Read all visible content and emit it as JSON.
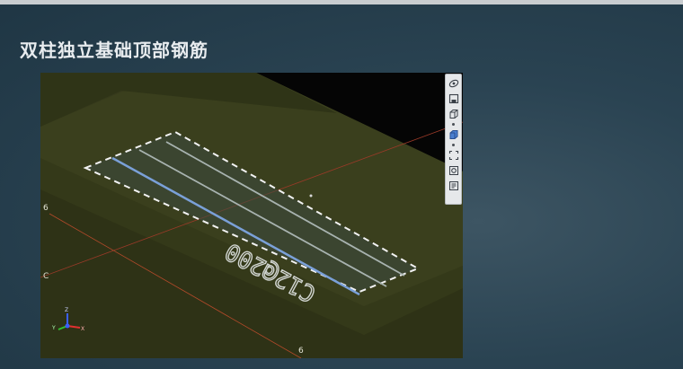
{
  "slide": {
    "title": "双柱独立基础顶部钢筋"
  },
  "viewport": {
    "rebar_label": "C12@200",
    "grid_labels": {
      "left_top": "6",
      "left_mid": "C",
      "bottom": "6"
    },
    "axis_labels": {
      "x": "X",
      "y": "Y",
      "z": "Z"
    }
  },
  "toolbar": {
    "buttons": [
      {
        "name": "orbit-icon"
      },
      {
        "name": "save-view-icon"
      },
      {
        "name": "cube-wire-icon"
      },
      {
        "name": "cube-solid-icon"
      },
      {
        "name": "fit-view-icon"
      },
      {
        "name": "settings-view-icon"
      },
      {
        "name": "properties-icon"
      }
    ]
  },
  "colors": {
    "viewport_bg": "#363a1c",
    "accent_rebar": "#7aa0d8",
    "grid_line": "#b44a2a"
  }
}
